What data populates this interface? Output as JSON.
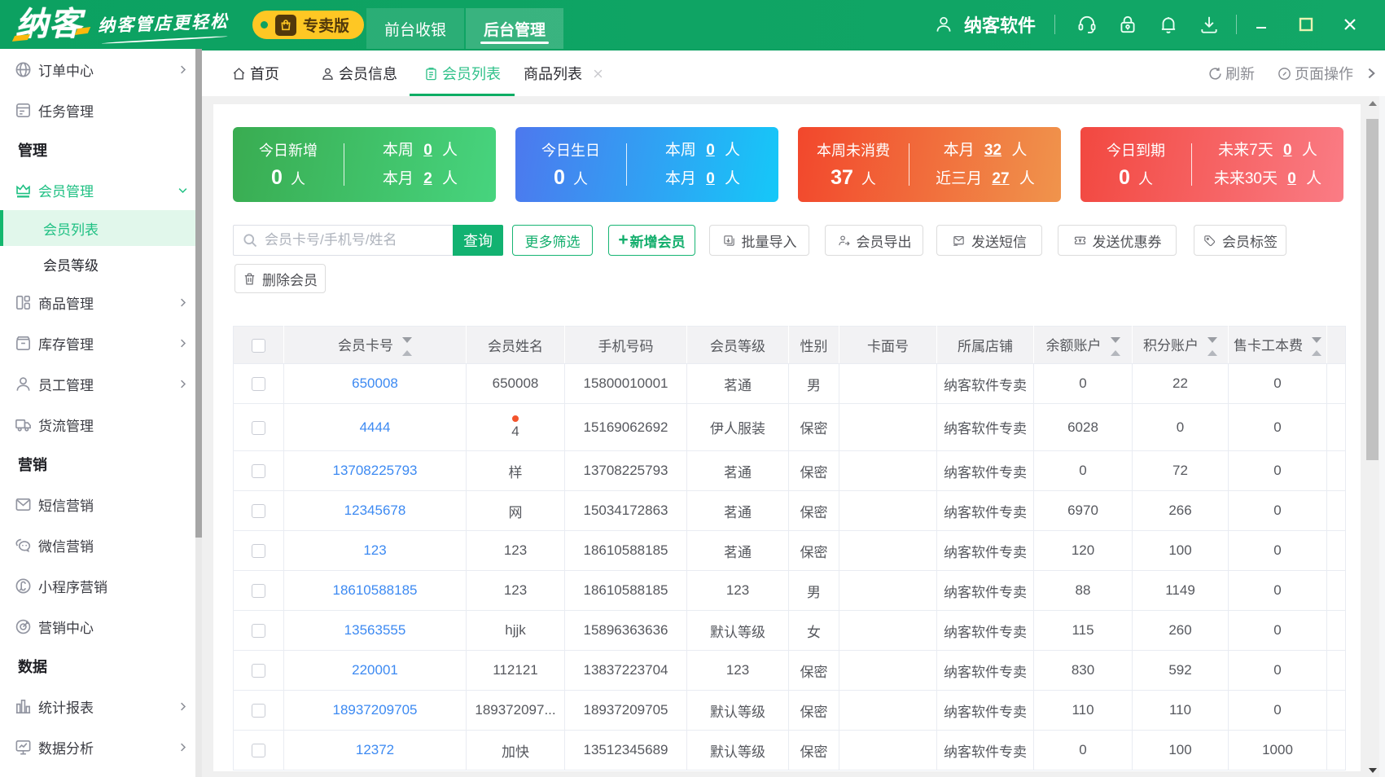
{
  "header": {
    "logo_text": "纳客",
    "slogan": "纳客管店更轻松",
    "badge_label": "专卖版",
    "nav_tabs": [
      {
        "label": "前台收银",
        "active": false
      },
      {
        "label": "后台管理",
        "active": true
      }
    ],
    "user_name": "纳客软件"
  },
  "sidebar": {
    "items": [
      {
        "type": "item",
        "icon": "globe-icon",
        "label": "订单中心",
        "arrow": "right"
      },
      {
        "type": "item",
        "icon": "task-icon",
        "label": "任务管理",
        "arrow": ""
      },
      {
        "type": "section",
        "label": "管理"
      },
      {
        "type": "item",
        "icon": "crown-icon",
        "label": "会员管理",
        "arrow": "down",
        "green": true
      },
      {
        "type": "sub",
        "label": "会员列表",
        "active": true
      },
      {
        "type": "sub",
        "label": "会员等级",
        "active": false
      },
      {
        "type": "item",
        "icon": "goods-icon",
        "label": "商品管理",
        "arrow": "right"
      },
      {
        "type": "item",
        "icon": "stock-icon",
        "label": "库存管理",
        "arrow": "right"
      },
      {
        "type": "item",
        "icon": "staff-icon",
        "label": "员工管理",
        "arrow": "right"
      },
      {
        "type": "item",
        "icon": "truck-icon",
        "label": "货流管理",
        "arrow": ""
      },
      {
        "type": "section",
        "label": "营销"
      },
      {
        "type": "item",
        "icon": "sms-icon",
        "label": "短信营销",
        "arrow": ""
      },
      {
        "type": "item",
        "icon": "wechat-icon",
        "label": "微信营销",
        "arrow": ""
      },
      {
        "type": "item",
        "icon": "miniapp-icon",
        "label": "小程序营销",
        "arrow": ""
      },
      {
        "type": "item",
        "icon": "target-icon",
        "label": "营销中心",
        "arrow": ""
      },
      {
        "type": "section",
        "label": "数据"
      },
      {
        "type": "item",
        "icon": "report-icon",
        "label": "统计报表",
        "arrow": "right"
      },
      {
        "type": "item",
        "icon": "analysis-icon",
        "label": "数据分析",
        "arrow": "right"
      }
    ]
  },
  "tabbar": {
    "tabs": [
      {
        "label": "首页",
        "icon": "home-icon",
        "active": false,
        "closable": false
      },
      {
        "label": "会员信息",
        "icon": "member-icon",
        "active": false,
        "closable": false
      },
      {
        "label": "会员列表",
        "icon": "list-icon",
        "active": true,
        "closable": false
      },
      {
        "label": "商品列表",
        "icon": "",
        "active": false,
        "closable": true
      }
    ],
    "refresh_label": "刷新",
    "page_ops_label": "页面操作"
  },
  "cards": [
    {
      "color": "green",
      "label": "今日新增",
      "big": "0",
      "unit": "人",
      "rows": [
        {
          "k": "本周",
          "v": "0",
          "u": "人"
        },
        {
          "k": "本月",
          "v": "2",
          "u": "人"
        }
      ]
    },
    {
      "color": "blue",
      "label": "今日生日",
      "big": "0",
      "unit": "人",
      "rows": [
        {
          "k": "本周",
          "v": "0",
          "u": "人"
        },
        {
          "k": "本月",
          "v": "0",
          "u": "人"
        }
      ]
    },
    {
      "color": "orange",
      "label": "本周未消费",
      "big": "37",
      "unit": "人",
      "rows": [
        {
          "k": "本月",
          "v": "32",
          "u": "人"
        },
        {
          "k": "近三月",
          "v": "27",
          "u": "人"
        }
      ]
    },
    {
      "color": "red",
      "label": "今日到期",
      "big": "0",
      "unit": "人",
      "rows": [
        {
          "k": "未来7天",
          "v": "0",
          "u": "人"
        },
        {
          "k": "未来30天",
          "v": "0",
          "u": "人"
        }
      ]
    }
  ],
  "toolbar": {
    "search_placeholder": "会员卡号/手机号/姓名",
    "search_value": "",
    "query_label": "查询",
    "more_filter_label": "更多筛选",
    "add_member_label": "新增会员",
    "add_member_plus": "+",
    "buttons": [
      {
        "icon": "import-icon",
        "label": "批量导入"
      },
      {
        "icon": "export-icon",
        "label": "会员导出"
      },
      {
        "icon": "sendsms-icon",
        "label": "发送短信"
      },
      {
        "icon": "coupon-icon",
        "label": "发送优惠券"
      },
      {
        "icon": "tag-icon",
        "label": "会员标签"
      }
    ],
    "delete_label": "删除会员"
  },
  "table": {
    "columns": [
      {
        "key": "cardno",
        "label": "会员卡号",
        "sortable": true
      },
      {
        "key": "name",
        "label": "会员姓名",
        "sortable": false
      },
      {
        "key": "phone",
        "label": "手机号码",
        "sortable": false
      },
      {
        "key": "level",
        "label": "会员等级",
        "sortable": false
      },
      {
        "key": "gender",
        "label": "性别",
        "sortable": false
      },
      {
        "key": "cardface",
        "label": "卡面号",
        "sortable": false
      },
      {
        "key": "store",
        "label": "所属店铺",
        "sortable": false
      },
      {
        "key": "balance",
        "label": "余额账户",
        "sortable": true
      },
      {
        "key": "points",
        "label": "积分账户",
        "sortable": true
      },
      {
        "key": "cardfee",
        "label": "售卡工本费",
        "sortable": true
      }
    ],
    "rows": [
      {
        "cardno": "650008",
        "name": "650008",
        "dot": false,
        "phone": "15800010001",
        "level": "茗通",
        "gender": "男",
        "cardface": "",
        "store": "纳客软件专卖",
        "balance": "0",
        "points": "22",
        "cardfee": "0"
      },
      {
        "cardno": "4444",
        "name": "4",
        "dot": true,
        "phone": "15169062692",
        "level": "伊人服装",
        "gender": "保密",
        "cardface": "",
        "store": "纳客软件专卖",
        "balance": "6028",
        "points": "0",
        "cardfee": "0"
      },
      {
        "cardno": "13708225793",
        "name": "样",
        "dot": false,
        "phone": "13708225793",
        "level": "茗通",
        "gender": "保密",
        "cardface": "",
        "store": "纳客软件专卖",
        "balance": "0",
        "points": "72",
        "cardfee": "0"
      },
      {
        "cardno": "12345678",
        "name": "网",
        "dot": false,
        "phone": "15034172863",
        "level": "茗通",
        "gender": "保密",
        "cardface": "",
        "store": "纳客软件专卖",
        "balance": "6970",
        "points": "266",
        "cardfee": "0"
      },
      {
        "cardno": "123",
        "name": "123",
        "dot": false,
        "phone": "18610588185",
        "level": "茗通",
        "gender": "保密",
        "cardface": "",
        "store": "纳客软件专卖",
        "balance": "120",
        "points": "100",
        "cardfee": "0"
      },
      {
        "cardno": "18610588185",
        "name": "123",
        "dot": false,
        "phone": "18610588185",
        "level": "123",
        "gender": "男",
        "cardface": "",
        "store": "纳客软件专卖",
        "balance": "88",
        "points": "1149",
        "cardfee": "0"
      },
      {
        "cardno": "13563555",
        "name": "hjjk",
        "dot": false,
        "phone": "15896363636",
        "level": "默认等级",
        "gender": "女",
        "cardface": "",
        "store": "纳客软件专卖",
        "balance": "115",
        "points": "260",
        "cardfee": "0"
      },
      {
        "cardno": "220001",
        "name": "112121",
        "dot": false,
        "phone": "13837223704",
        "level": "123",
        "gender": "保密",
        "cardface": "",
        "store": "纳客软件专卖",
        "balance": "830",
        "points": "592",
        "cardfee": "0"
      },
      {
        "cardno": "18937209705",
        "name": "189372097...",
        "dot": false,
        "phone": "18937209705",
        "level": "默认等级",
        "gender": "保密",
        "cardface": "",
        "store": "纳客软件专卖",
        "balance": "110",
        "points": "110",
        "cardfee": "0"
      },
      {
        "cardno": "12372",
        "name": "加快",
        "dot": false,
        "phone": "13512345689",
        "level": "默认等级",
        "gender": "保密",
        "cardface": "",
        "store": "纳客软件专卖",
        "balance": "0",
        "points": "100",
        "cardfee": "1000"
      }
    ]
  },
  "colors": {
    "header_green": "#0ca161",
    "accent_green": "#12b56d",
    "link_blue": "#3d8af2",
    "badge_yellow": "#fec724"
  }
}
